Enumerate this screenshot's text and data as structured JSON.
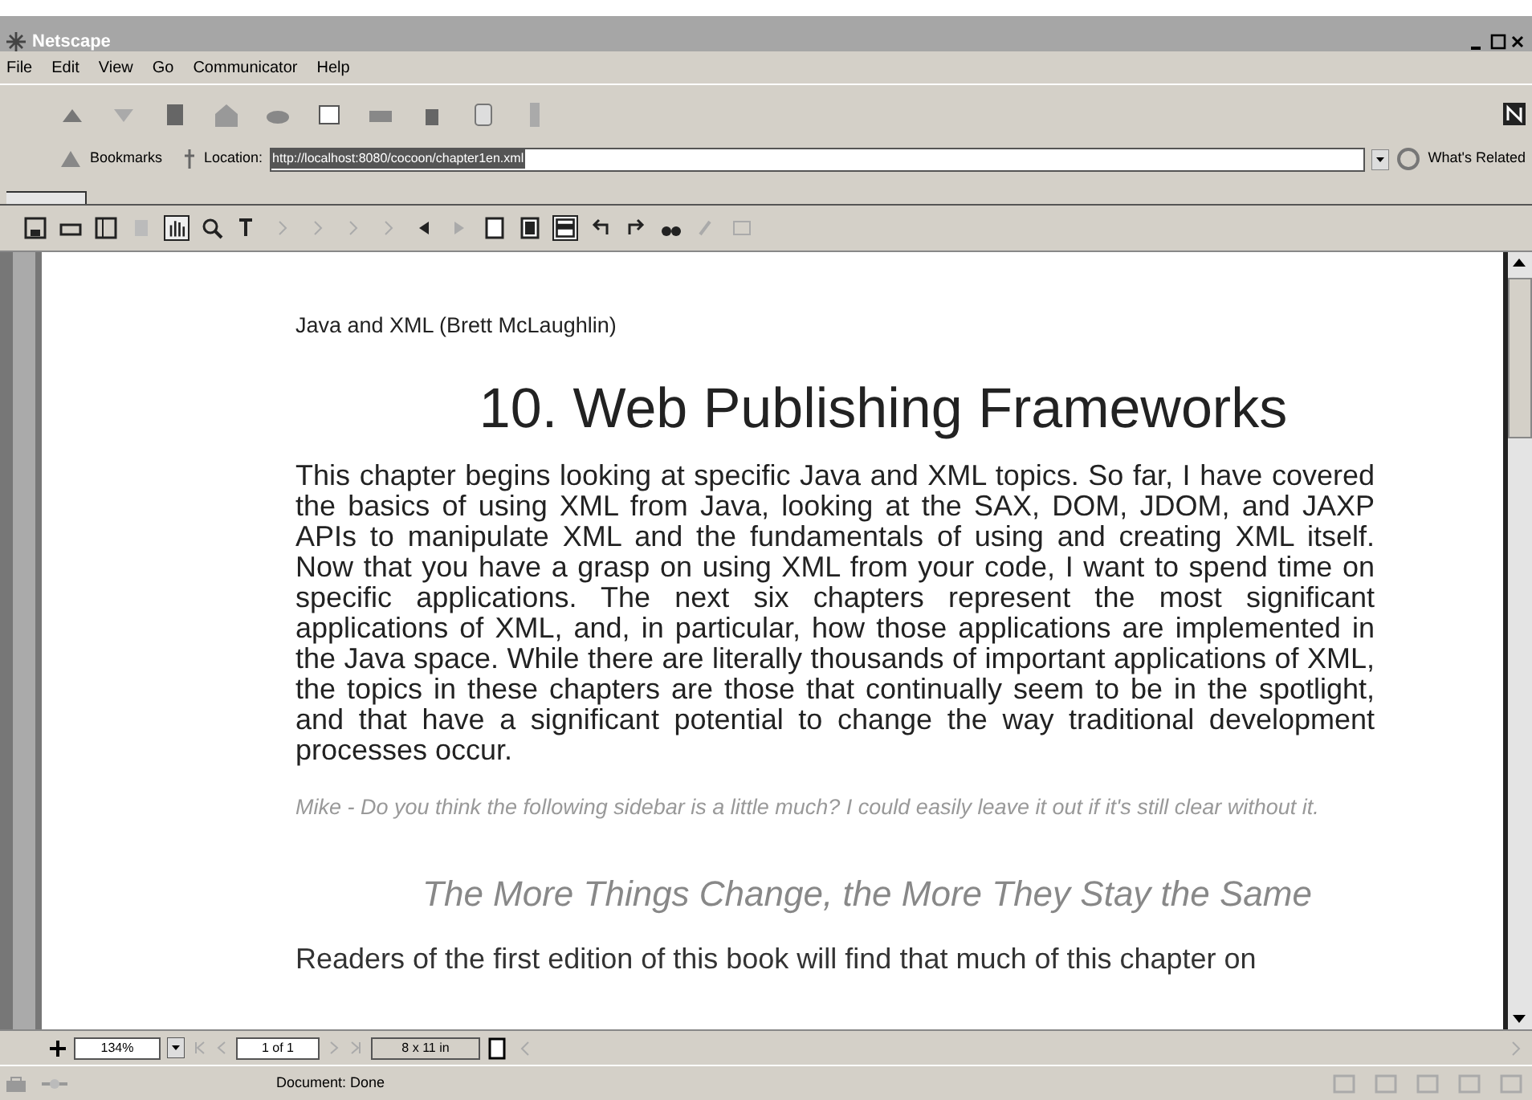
{
  "window": {
    "title": "Netscape"
  },
  "menu": [
    "File",
    "Edit",
    "View",
    "Go",
    "Communicator",
    "Help"
  ],
  "location_bar": {
    "bookmarks": "Bookmarks",
    "location_label": "Location:",
    "url": "http://localhost:8080/cocoon/chapter1en.xml",
    "related": "What's Related"
  },
  "pdf_toolbar": {
    "tools": [
      {
        "kind": "hand",
        "selected": true
      },
      {
        "kind": "zoom",
        "selected": false
      }
    ],
    "views": [
      {
        "kind": "actual",
        "selected": false
      },
      {
        "kind": "fit-page",
        "selected": false
      },
      {
        "kind": "fit-width",
        "selected": true
      }
    ]
  },
  "document": {
    "header": "Java and XML (Brett McLaughlin)",
    "title": "10. Web Publishing Frameworks",
    "paragraph": "This chapter begins looking at specific Java and XML topics. So far, I have covered the basics of using XML from Java, looking at the SAX, DOM, JDOM, and JAXP APIs to manipulate XML and the fundamentals of using and creating XML itself. Now that you have a grasp on using XML from your code, I want to spend time on specific applications. The next six chapters represent the most significant applications of XML, and, in particular, how those applications are implemented in the Java space. While there are literally thousands of important applications of XML, the topics in these chapters are those that continually seem to be in the spotlight, and that have a significant potential to change the way traditional development processes occur.",
    "note": "Mike - Do you think the following sidebar is a little much? I could easily leave it out if it's still clear without it.",
    "sidebar_heading": "The More Things Change, the More They Stay the Same",
    "last_line": "Readers of the first edition of this book will find that much of this chapter on"
  },
  "pdf_statusbar": {
    "zoom": "134%",
    "page": "1 of 1",
    "page_size": "8 x 11 in"
  },
  "status_bar": {
    "text": "Document: Done"
  }
}
